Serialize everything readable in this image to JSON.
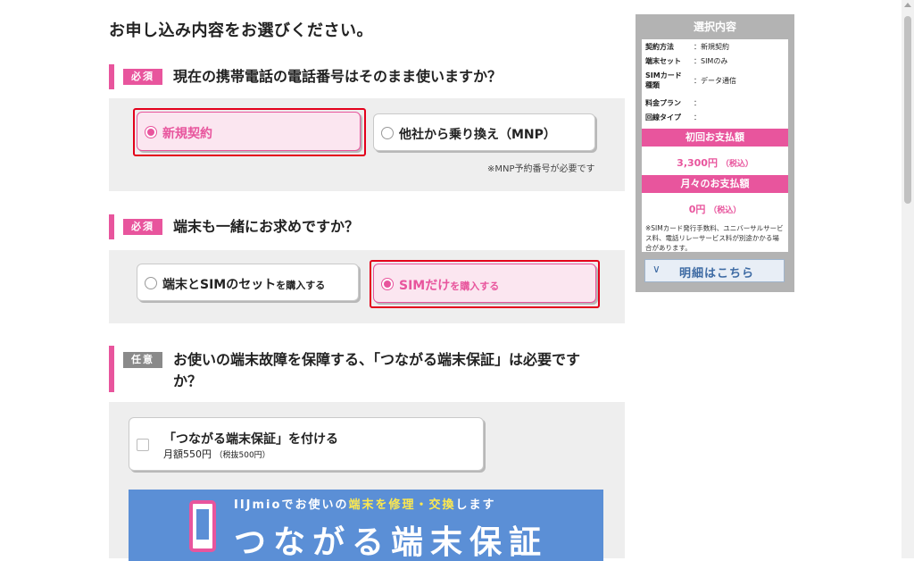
{
  "page": {
    "title": "お申し込み内容をお選びください。"
  },
  "q1": {
    "tag": "必須",
    "question": "現在の携帯電話の電話番号はそのまま使いますか？",
    "options": [
      {
        "label": "新規契約",
        "selected": true
      },
      {
        "label": "他社から乗り換え（MNP）",
        "selected": false
      }
    ],
    "note": "※MNP予約番号が必要です"
  },
  "q2": {
    "tag": "必須",
    "question": "端末も一緒にお求めですか？",
    "options": [
      {
        "label_main": "端末とSIMのセット",
        "label_small": "を購入する",
        "selected": false
      },
      {
        "label_main": "SIMだけ",
        "label_small": "を購入する",
        "selected": true
      }
    ]
  },
  "q3": {
    "tag": "任意",
    "question_line1": "お使いの端末故障を保障する、「つながる端末保証」は必要です",
    "question_line2": "か？",
    "checkbox": {
      "label": "「つながる端末保証」を付ける",
      "price": "月額550円",
      "price_sub": "（税抜500円）",
      "checked": false
    },
    "banner": {
      "sub_pre": "IIJmioでお使いの",
      "sub_hl": "端末を修理・交換",
      "sub_post": "します",
      "main": "つながる端末保証"
    }
  },
  "sidebar": {
    "title": "選択内容",
    "rows": [
      {
        "key": "契約方法",
        "value": "：新規契約"
      },
      {
        "key": "端末セット",
        "value": "：SIMのみ"
      },
      {
        "key": "SIMカード",
        "key2": "種類",
        "value": "：データ通信"
      },
      {
        "key": "料金プラン",
        "value": "："
      },
      {
        "key": "回線タイプ",
        "value": "："
      }
    ],
    "initial_payment_label": "初回お支払額",
    "initial_payment_value": "3,300円",
    "initial_payment_tax": "（税込）",
    "monthly_payment_label": "月々のお支払額",
    "monthly_payment_value": "0円",
    "monthly_payment_tax": "（税込）",
    "note": "※SIMカード発行手数料、ユニバーサルサービス料、電話リレーサービス料が別途かかる場合があります。",
    "detail_button": "明細はこちら"
  },
  "colors": {
    "accent": "#e8559d",
    "highlight_frame": "#e3001b",
    "sidebar_bg": "#b3b3b3",
    "banner_bg": "#5b8fd6"
  }
}
